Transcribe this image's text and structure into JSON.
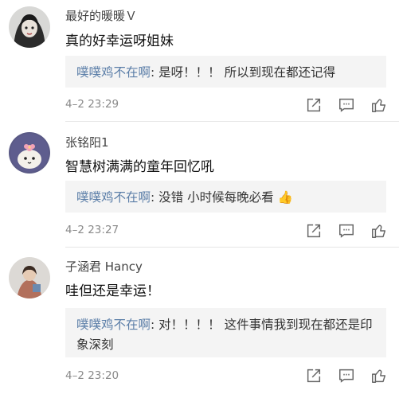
{
  "comments": [
    {
      "username": "最好的暖暖Ｖ",
      "text": "真的好幸运呀姐妹",
      "reply_user": "噗噗鸡不在啊",
      "reply_text": ": 是呀！！！ 所以到现在都还记得",
      "time": "4–2 23:29"
    },
    {
      "username": "张铭阳1",
      "text": "智慧树满满的童年回忆吼",
      "reply_user": "噗噗鸡不在啊",
      "reply_text": ": 没错 小时候每晚必看 👍",
      "time": "4–2 23:27"
    },
    {
      "username": "子涵君 Hancy",
      "text": "哇但还是幸运！",
      "reply_user": "噗噗鸡不在啊",
      "reply_text": ": 对！！！！ 这件事情我到现在都还是印象深刻",
      "time": "4–2 23:20"
    }
  ],
  "icons": {
    "share": "share-icon",
    "comment": "comment-icon",
    "like": "thumbs-up-icon"
  },
  "colors": {
    "reply_name": "#5b7ea8",
    "reply_bg": "#f4f4f4",
    "time": "#8a8a8a"
  }
}
